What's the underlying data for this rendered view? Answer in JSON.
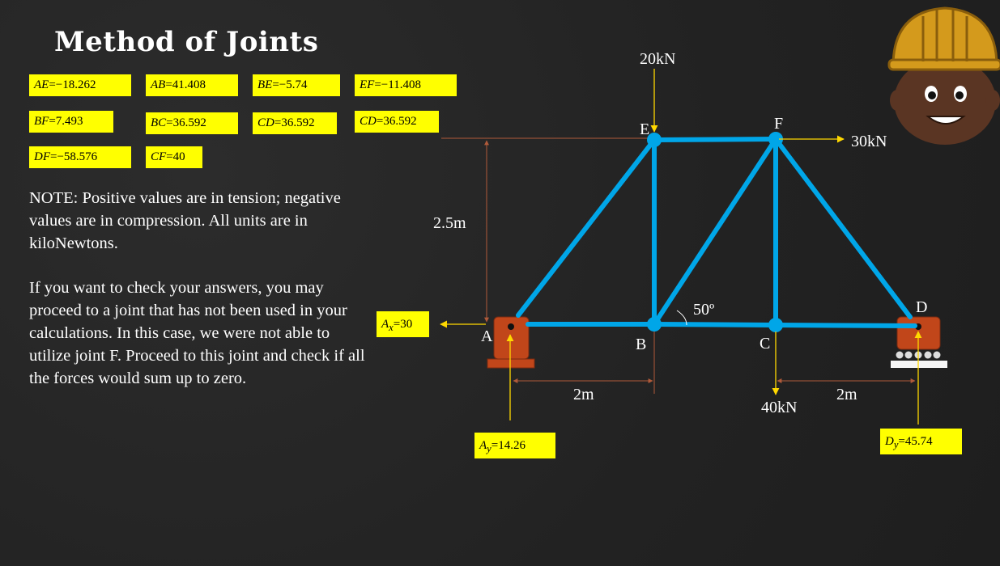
{
  "title": "Method of Joints",
  "member_forces": [
    {
      "member": "AE",
      "value": "−18.262"
    },
    {
      "member": "AB",
      "value": "41.408"
    },
    {
      "member": "BE",
      "value": "−5.74"
    },
    {
      "member": "EF",
      "value": "−11.408"
    },
    {
      "member": "BF",
      "value": "7.493"
    },
    {
      "member": "BC",
      "value": "36.592"
    },
    {
      "member": "CD",
      "value": "36.592"
    },
    {
      "member": "CD",
      "value": "36.592"
    },
    {
      "member": "DF",
      "value": "−58.576"
    },
    {
      "member": "CF",
      "value": "40"
    }
  ],
  "notes": {
    "note1": "NOTE: Positive values are in tension; negative values are in compression. All units are in kiloNewtons.",
    "note2": "If you want to check your answers, you may proceed to a joint that has not been used in your calculations. In this case, we were not able to utilize joint F. Proceed to this joint and check if all the forces would sum up to zero."
  },
  "diagram": {
    "joints": {
      "A": "A",
      "B": "B",
      "C": "C",
      "D": "D",
      "E": "E",
      "F": "F"
    },
    "loads": {
      "top": "20kN",
      "right": "30kN",
      "bottom": "40kN"
    },
    "dimensions": {
      "height": "2.5m",
      "span_left": "2m",
      "span_right": "2m"
    },
    "angle": "50º",
    "reactions": {
      "Ax": {
        "symbol": "A",
        "sub": "x",
        "value": "30"
      },
      "Ay": {
        "symbol": "A",
        "sub": "y",
        "value": "14.26"
      },
      "Dy": {
        "symbol": "D",
        "sub": "y",
        "value": "45.74"
      }
    }
  },
  "colors": {
    "member": "#00a6e8",
    "support": "#c1461a",
    "arrow": "#ffd800",
    "label_bg": "#ffff00",
    "dim_line": "#b05a3a"
  }
}
